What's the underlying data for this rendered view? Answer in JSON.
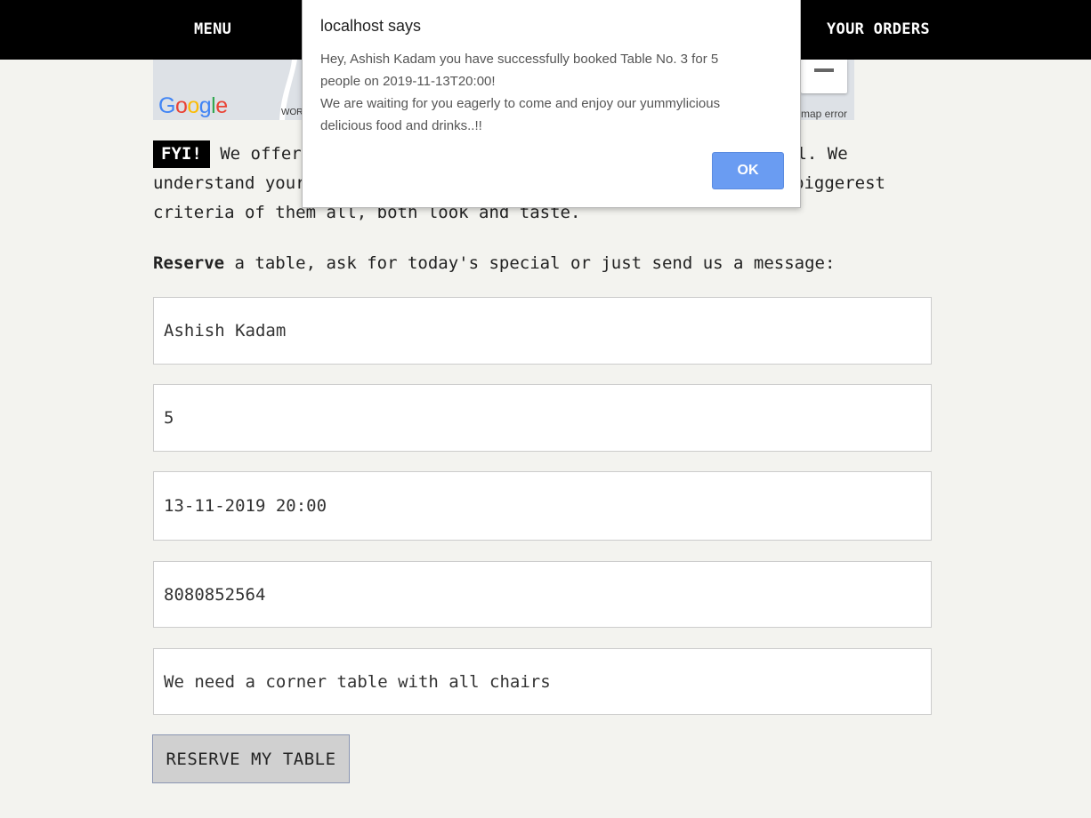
{
  "nav": {
    "menu_label": "MENU",
    "orders_label": "YOUR ORDERS"
  },
  "map": {
    "logo_text": "Google",
    "label_fragment": "WOR",
    "error_text": "map error"
  },
  "intro": {
    "badge": "FYI!",
    "line1_start": "We offer",
    "line1_end": "ll. We",
    "line2_start": "understand your",
    "line2_end": "biggerest",
    "line3": "criteria of them all, both look and taste."
  },
  "reserve": {
    "bold": "Reserve",
    "rest": " a table, ask for today's special or just send us a message:"
  },
  "form": {
    "name": "Ashish Kadam",
    "people": "5",
    "datetime": "13-11-2019 20:00",
    "phone": "8080852564",
    "message": "We need a corner table with all chairs",
    "submit_label": "RESERVE MY TABLE"
  },
  "dialog": {
    "title": "localhost says",
    "line1": "Hey, Ashish Kadam you have successfully booked Table No. 3 for 5",
    "line2": "people on 2019-11-13T20:00!",
    "line3": "We are waiting for you eagerly to come and enjoy our yummylicious",
    "line4": "delicious food and drinks..!!",
    "ok_label": "OK"
  },
  "colors": {
    "nav_bg": "#000000",
    "page_bg": "#f3f3ef",
    "ok_button": "#6a9cf2"
  }
}
